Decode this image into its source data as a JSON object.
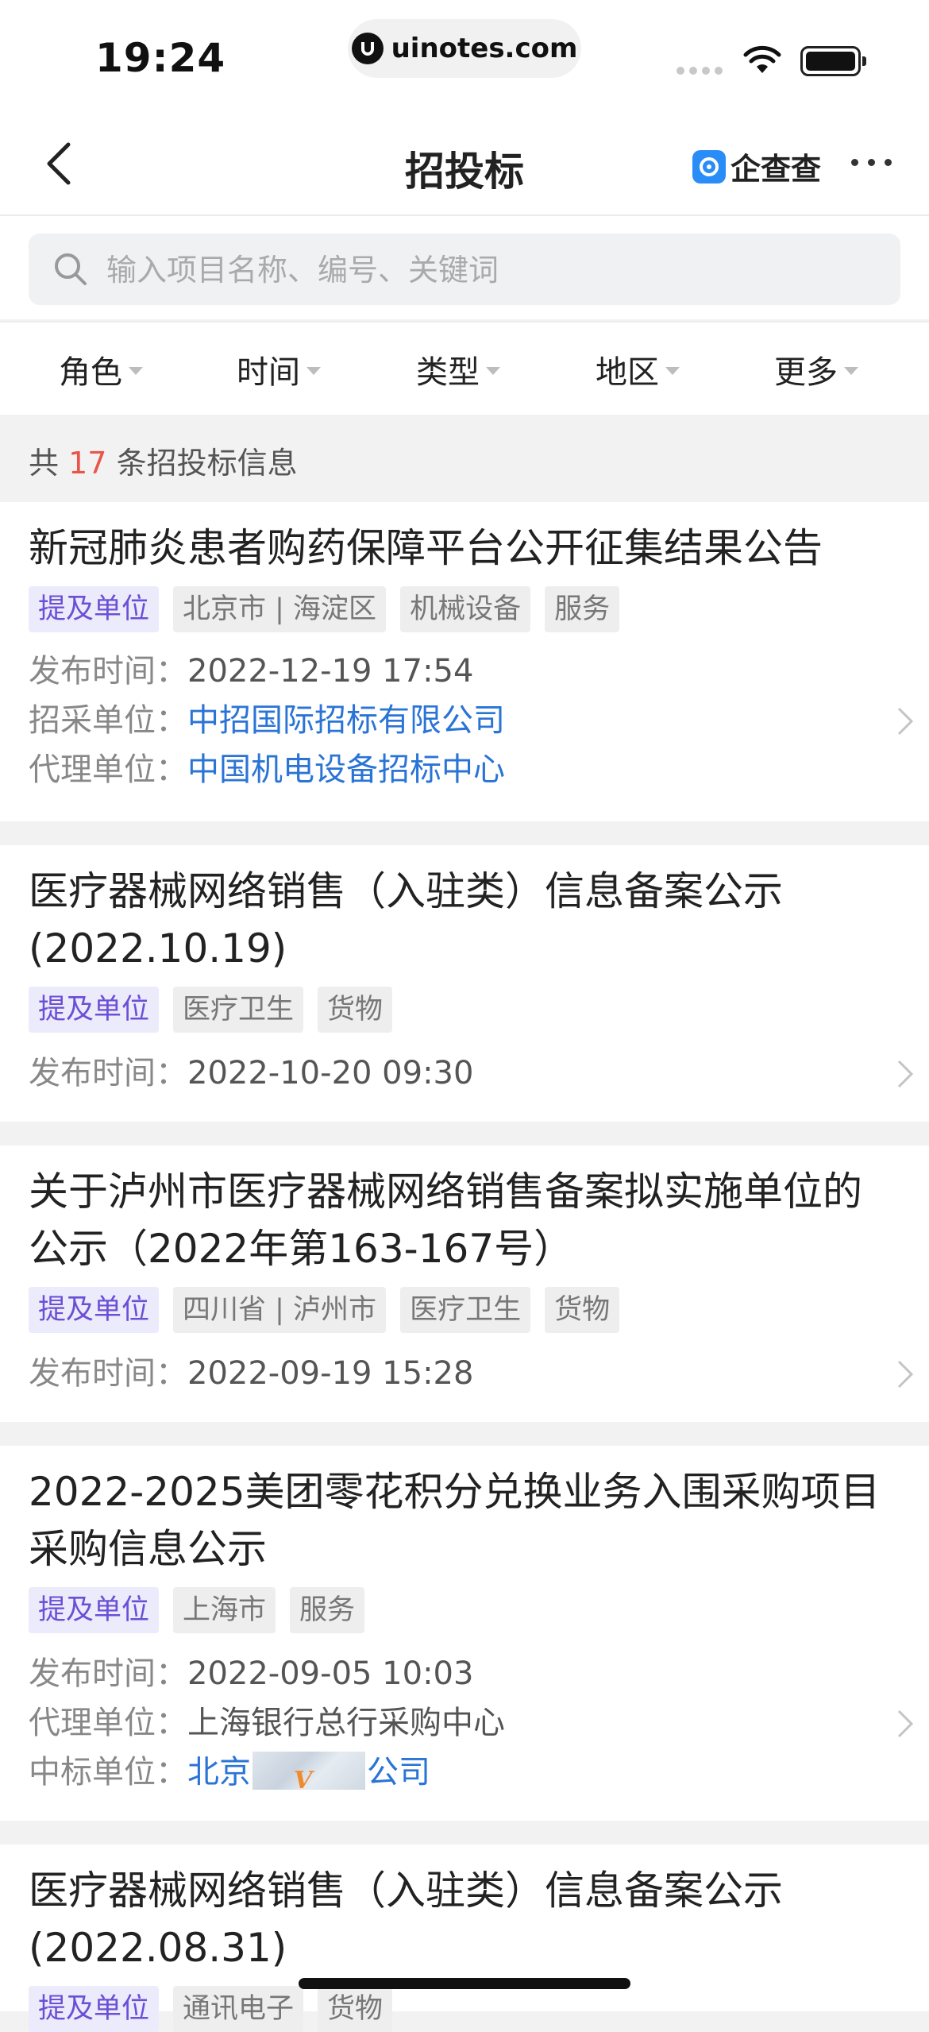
{
  "status_bar": {
    "time": "19:24",
    "url": "uinotes.com"
  },
  "nav": {
    "title": "招投标",
    "brand": "企查查"
  },
  "search": {
    "placeholder": "输入项目名称、编号、关键词"
  },
  "filters": [
    "角色",
    "时间",
    "类型",
    "地区",
    "更多"
  ],
  "summary": {
    "prefix": "共",
    "count": "17",
    "suffix": "条招投标信息"
  },
  "records": [
    {
      "title": "新冠肺炎患者购药保障平台公开征集结果公告",
      "tags": [
        "提及单位",
        "北京市 | 海淀区",
        "机械设备",
        "服务"
      ],
      "meta": [
        {
          "label": "发布时间：",
          "value": "2022-12-19 17:54",
          "style": "plain"
        },
        {
          "label": "招采单位：",
          "value": "中招国际招标有限公司",
          "style": "link"
        },
        {
          "label": "代理单位：",
          "value": "中国机电设备招标中心",
          "style": "link"
        }
      ]
    },
    {
      "title": "医疗器械网络销售（入驻类）信息备案公示(2022.10.19)",
      "tags": [
        "提及单位",
        "医疗卫生",
        "货物"
      ],
      "meta": [
        {
          "label": "发布时间：",
          "value": "2022-10-20 09:30",
          "style": "plain"
        }
      ]
    },
    {
      "title": "关于泸州市医疗器械网络销售备案拟实施单位的公示（2022年第163-167号）",
      "tags": [
        "提及单位",
        "四川省 | 泸州市",
        "医疗卫生",
        "货物"
      ],
      "meta": [
        {
          "label": "发布时间：",
          "value": "2022-09-19 15:28",
          "style": "plain"
        }
      ]
    },
    {
      "title": "2022-2025美团零花积分兑换业务入围采购项目采购信息公示",
      "tags": [
        "提及单位",
        "上海市",
        "服务"
      ],
      "meta": [
        {
          "label": "发布时间：",
          "value": "2022-09-05 10:03",
          "style": "plain"
        },
        {
          "label": "代理单位：",
          "value": "上海银行总行采购中心",
          "style": "plain"
        },
        {
          "label": "中标单位：",
          "value_start": "北京",
          "value_end": "公司",
          "vip_mark": "V",
          "style": "link-blur"
        }
      ]
    },
    {
      "title": "医疗器械网络销售（入驻类）信息备案公示(2022.08.31)",
      "tags": [
        "提及单位",
        "通讯电子",
        "货物"
      ],
      "meta": []
    }
  ]
}
